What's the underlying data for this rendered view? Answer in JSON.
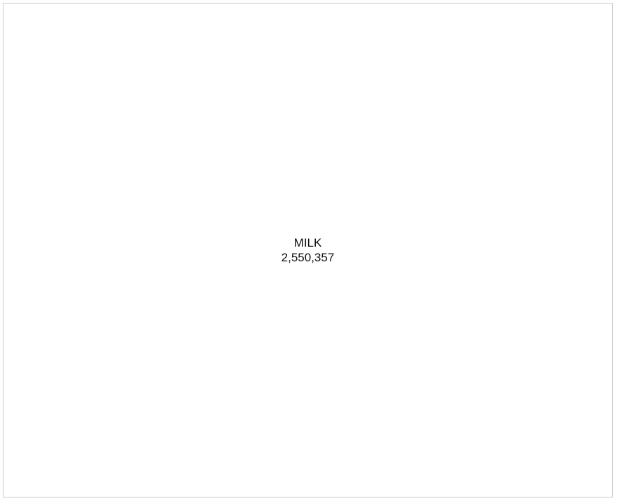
{
  "chart_data": {
    "type": "treemap",
    "items": [
      {
        "label": "MILK",
        "value": 2550357,
        "display_value": "2,550,357"
      }
    ],
    "colors": {
      "background": "#ffffff",
      "border": "#cccccc",
      "text": "#111111"
    }
  }
}
